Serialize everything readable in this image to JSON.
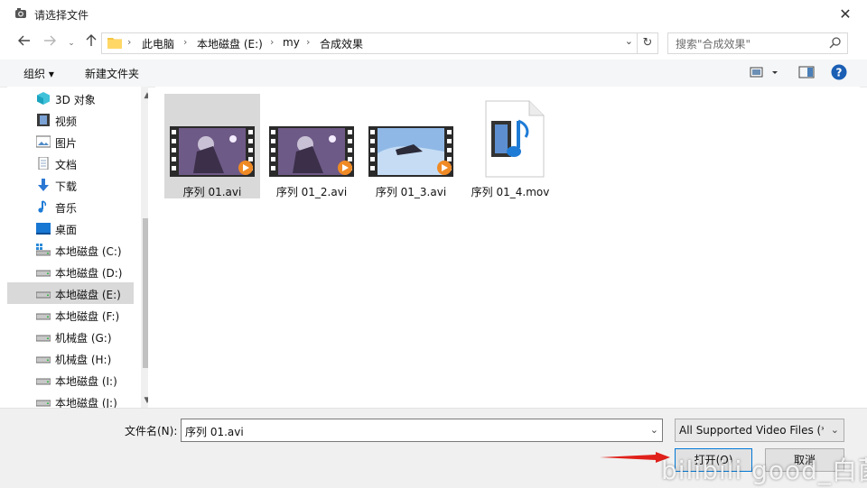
{
  "window": {
    "title": "请选择文件"
  },
  "address": {
    "crumbs": [
      "此电脑",
      "本地磁盘 (E:)",
      "my",
      "合成效果"
    ]
  },
  "search": {
    "placeholder": "搜索\"合成效果\""
  },
  "toolbar": {
    "organize": "组织 ▾",
    "new_folder": "新建文件夹"
  },
  "sidebar": {
    "items": [
      {
        "label": "3D 对象",
        "icon": "cube-icon"
      },
      {
        "label": "视频",
        "icon": "video-icon"
      },
      {
        "label": "图片",
        "icon": "picture-icon"
      },
      {
        "label": "文档",
        "icon": "document-icon"
      },
      {
        "label": "下载",
        "icon": "download-icon"
      },
      {
        "label": "音乐",
        "icon": "music-icon"
      },
      {
        "label": "桌面",
        "icon": "desktop-icon"
      },
      {
        "label": "本地磁盘 (C:)",
        "icon": "system-drive-icon"
      },
      {
        "label": "本地磁盘 (D:)",
        "icon": "drive-icon"
      },
      {
        "label": "本地磁盘 (E:)",
        "icon": "drive-icon",
        "selected": true
      },
      {
        "label": "本地磁盘 (F:)",
        "icon": "drive-icon"
      },
      {
        "label": " 机械盘 (G:)",
        "icon": "drive-icon"
      },
      {
        "label": "机械盘 (H:)",
        "icon": "drive-icon"
      },
      {
        "label": "本地磁盘 (I:)",
        "icon": "drive-icon"
      },
      {
        "label": "本地磁盘 (J:)",
        "icon": "drive-icon"
      }
    ]
  },
  "files": [
    {
      "name": "序列 01.avi",
      "kind": "avi-video",
      "selected": true
    },
    {
      "name": "序列 01_2.avi",
      "kind": "avi-video"
    },
    {
      "name": "序列 01_3.avi",
      "kind": "avi-video"
    },
    {
      "name": "序列 01_4.mov",
      "kind": "mov-video"
    }
  ],
  "footer": {
    "filename_label": "文件名(N):",
    "filename_value": "序列 01.avi",
    "filetype_value": "All Supported Video Files (*.",
    "open_label": "打开(O)",
    "cancel_label": "取消"
  },
  "watermark": "bilibili good_白菌",
  "colors": {
    "accent": "#0078d7",
    "selection": "#d9d9d9",
    "arrow": "#e0201a"
  }
}
